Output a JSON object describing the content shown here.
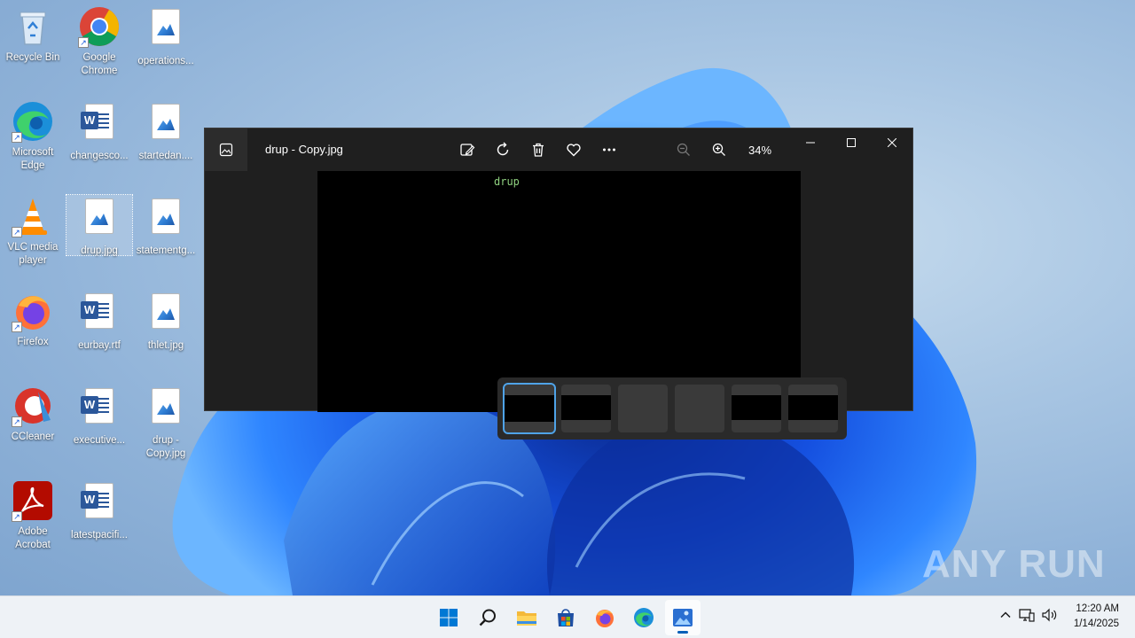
{
  "desktop": {
    "icons": [
      {
        "label": "Recycle Bin"
      },
      {
        "label": "Google Chrome"
      },
      {
        "label": "operations..."
      },
      {
        "label": "Microsoft Edge"
      },
      {
        "label": "changesco..."
      },
      {
        "label": "startedan...."
      },
      {
        "label": "VLC media player"
      },
      {
        "label": "drup.jpg"
      },
      {
        "label": "statementg..."
      },
      {
        "label": "Firefox"
      },
      {
        "label": "eurbay.rtf"
      },
      {
        "label": "thlet.jpg"
      },
      {
        "label": "CCleaner"
      },
      {
        "label": "executive..."
      },
      {
        "label": "drup - Copy.jpg"
      },
      {
        "label": "Adobe Acrobat"
      },
      {
        "label": "latestpacifi..."
      }
    ]
  },
  "photos_window": {
    "file_name": "drup - Copy.jpg",
    "zoom": "34%",
    "image_text": "drup",
    "toolbar": [
      "edit-image",
      "rotate",
      "delete",
      "favorite",
      "more"
    ]
  },
  "watermark": "ANY RUN",
  "taskbar": {
    "time": "12:20 AM",
    "date": "1/14/2025"
  },
  "colors": {
    "accent": "#005fb8",
    "window_bg": "#1f1f1f",
    "selection": "#4fa3e8"
  }
}
